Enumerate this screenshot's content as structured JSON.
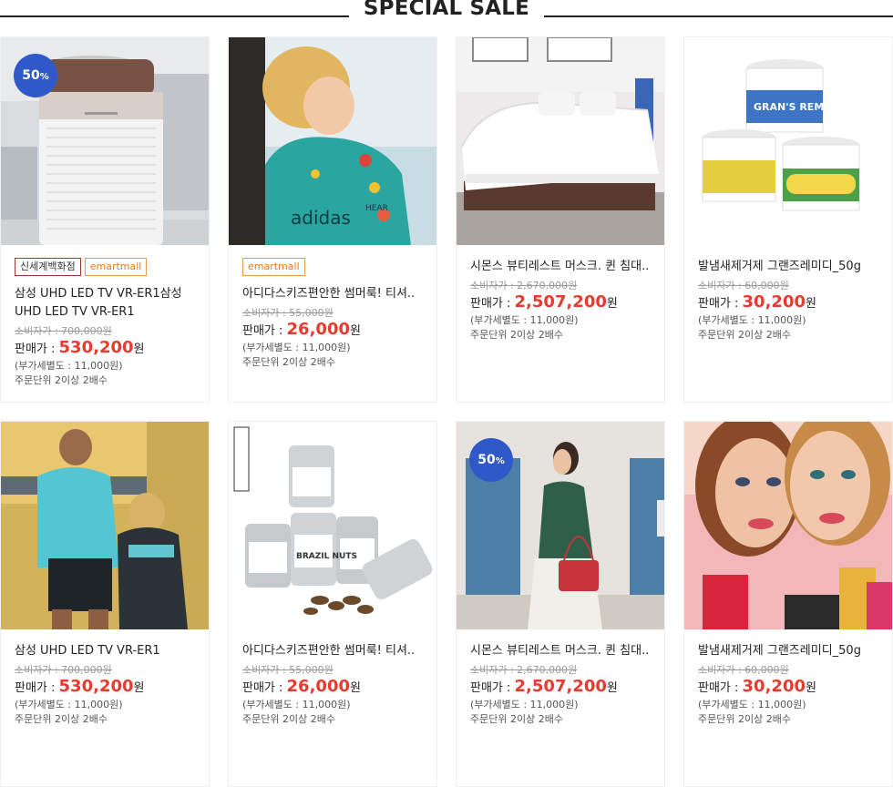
{
  "section": {
    "title": "SPECIAL SALE"
  },
  "products": [
    {
      "badge": "50",
      "badge_unit": "%",
      "tags": [
        "신세계백화점",
        "emartmall"
      ],
      "name": "삼성 UHD LED TV VR-ER1삼성 UHD LED TV VR-ER1",
      "msrp": "소비자가 : 700,000원",
      "sale_label": "판매가 : ",
      "sale_price": "530,200",
      "won": "원",
      "vat": "(부가세별도 : 11,000원)",
      "order_unit": "주문단위 2이상 2배수"
    },
    {
      "badge": "",
      "badge_unit": "",
      "tags": [
        "emartmall"
      ],
      "name": "아디다스키즈편안한 썸머룩! 티셔..",
      "msrp": "소비자가 : 55,000원",
      "sale_label": "판매가 : ",
      "sale_price": "26,000",
      "won": "원",
      "vat": "(부가세별도 : 11,000원)",
      "order_unit": "주문단위 2이상 2배수"
    },
    {
      "badge": "",
      "badge_unit": "",
      "tags": [],
      "name": "시몬스 뷰티레스트 머스크. 퀸 침대..",
      "msrp": "소비자가 : 2,670,000원",
      "sale_label": "판매가 : ",
      "sale_price": "2,507,200",
      "won": "원",
      "vat": "(부가세별도 : 11,000원)",
      "order_unit": "주문단위 2이상 2배수"
    },
    {
      "badge": "",
      "badge_unit": "",
      "tags": [],
      "name": "발냄새제거제 그랜즈레미디_50g",
      "msrp": "소비자가 : 60,000원",
      "sale_label": "판매가 : ",
      "sale_price": "30,200",
      "won": "원",
      "vat": "(부가세별도 : 11,000원)",
      "order_unit": "주문단위 2이상 2배수"
    },
    {
      "badge": "",
      "badge_unit": "",
      "tags": [],
      "name": "삼성 UHD LED TV VR-ER1",
      "msrp": "소비자가 : 700,000원",
      "sale_label": "판매가 : ",
      "sale_price": "530,200",
      "won": "원",
      "vat": "(부가세별도 : 11,000원)",
      "order_unit": "주문단위 2이상 2배수"
    },
    {
      "badge": "",
      "badge_unit": "",
      "tags": [],
      "name": "아디다스키즈편안한 썸머룩! 티셔..",
      "msrp": "소비자가 : 55,000원",
      "sale_label": "판매가 : ",
      "sale_price": "26,000",
      "won": "원",
      "vat": "(부가세별도 : 11,000원)",
      "order_unit": "주문단위 2이상 2배수"
    },
    {
      "badge": "50",
      "badge_unit": "%",
      "tags": [],
      "name": "시몬스 뷰티레스트 머스크. 퀸 침대..",
      "msrp": "소비자가 : 2,670,000원",
      "sale_label": "판매가 : ",
      "sale_price": "2,507,200",
      "won": "원",
      "vat": "(부가세별도 : 11,000원)",
      "order_unit": "주문단위 2이상 2배수"
    },
    {
      "badge": "",
      "badge_unit": "",
      "tags": [],
      "name": "발냄새제거제 그랜즈레미디_50g",
      "msrp": "소비자가 : 60,000원",
      "sale_label": "판매가 : ",
      "sale_price": "30,200",
      "won": "원",
      "vat": "(부가세별도 : 11,000원)",
      "order_unit": "주문단위 2이상 2배수"
    }
  ],
  "product_images": {
    "jar_label_brand": "GRAN'S REMEDY",
    "nuts_label": "BRAZIL NUTS",
    "shirt_brand": "adidas",
    "shirt_print": "HEAR"
  },
  "colors": {
    "accent": "#e83a2e",
    "badge": "#2f59c9",
    "emart_tag": "#e07b1e",
    "ssg_tag_border": "#a0392c"
  }
}
